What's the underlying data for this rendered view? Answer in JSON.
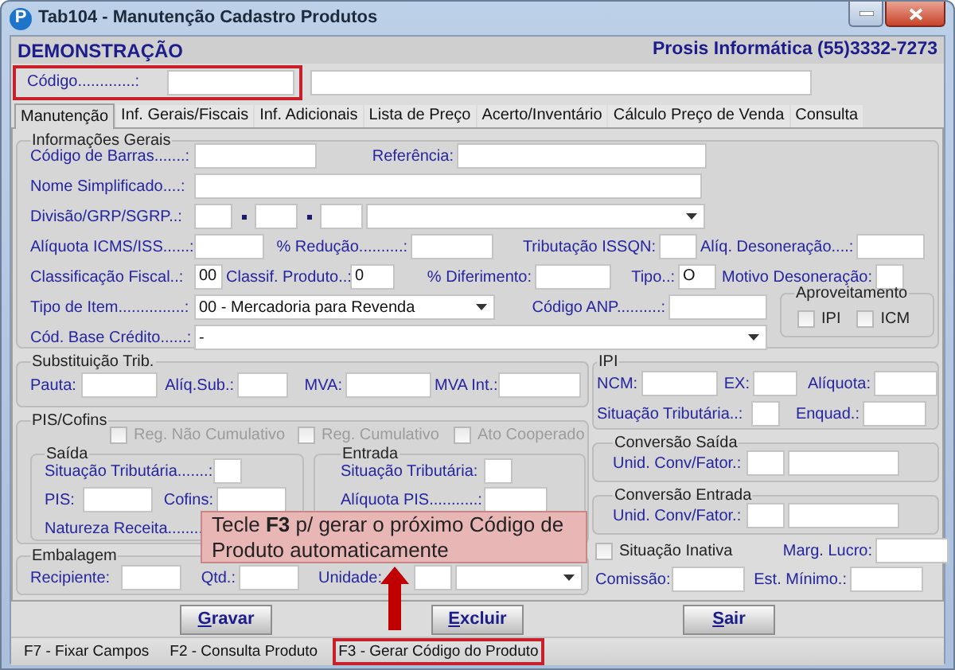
{
  "window": {
    "icon_letter": "P",
    "title": "Tab104 - Manutenção Cadastro Produtos"
  },
  "header": {
    "company": "DEMONSTRAÇÃO",
    "vendor": "Prosis Informática (55)3332-7273"
  },
  "code_row": {
    "highlighted": true,
    "items": [
      {
        "kind": "label",
        "text": "Código.............:"
      },
      {
        "kind": "input"
      },
      {
        "kind": "input"
      }
    ]
  },
  "tabs": [
    {
      "label": "Manutenção",
      "selected": true
    },
    {
      "label": "Inf. Gerais/Fiscais",
      "selected": false
    },
    {
      "label": "Inf. Adicionais",
      "selected": false
    },
    {
      "label": "Lista de Preço",
      "selected": false
    },
    {
      "label": "Acerto/Inventário",
      "selected": false
    },
    {
      "label": "Cálculo Preço de Venda",
      "selected": false
    },
    {
      "label": "Consulta",
      "selected": false
    }
  ],
  "general": {
    "title": "Informações Gerais",
    "rows": [
      {
        "fields": [
          {
            "kind": "label",
            "text": "Código de Barras.......:"
          },
          {
            "kind": "input"
          },
          {
            "kind": "label",
            "text": "Referência:"
          },
          {
            "kind": "input"
          }
        ]
      },
      {
        "fields": [
          {
            "kind": "label",
            "text": "Nome Simplificado....:"
          },
          {
            "kind": "input"
          }
        ]
      },
      {
        "fields": [
          {
            "kind": "label",
            "text": "Divisão/GRP/SGRP..:"
          },
          {
            "kind": "input"
          },
          {
            "kind": "dot"
          },
          {
            "kind": "input"
          },
          {
            "kind": "dot"
          },
          {
            "kind": "input"
          },
          {
            "kind": "select"
          }
        ]
      },
      {
        "fields": [
          {
            "kind": "label",
            "text": "Alíquota ICMS/ISS......:"
          },
          {
            "kind": "input"
          },
          {
            "kind": "label",
            "text": "% Redução..........:"
          },
          {
            "kind": "input"
          },
          {
            "kind": "label",
            "text": "Tributação ISSQN:"
          },
          {
            "kind": "input"
          },
          {
            "kind": "label",
            "text": "Alíq. Desoneração....:"
          },
          {
            "kind": "input"
          }
        ]
      },
      {
        "fields": [
          {
            "kind": "label",
            "text": "Classificação Fiscal..:"
          },
          {
            "kind": "input",
            "value": "00"
          },
          {
            "kind": "label",
            "text": "Classif. Produto..:"
          },
          {
            "kind": "input",
            "value": "0"
          },
          {
            "kind": "label",
            "text": "% Diferimento:"
          },
          {
            "kind": "input"
          },
          {
            "kind": "label",
            "text": "Tipo..:"
          },
          {
            "kind": "input",
            "value": "O"
          },
          {
            "kind": "label",
            "text": "Motivo Desoneração:"
          },
          {
            "kind": "input"
          }
        ]
      }
    ],
    "side_rows": [
      {
        "fields": [
          {
            "kind": "label",
            "text": "Tipo de Item...............:"
          },
          {
            "kind": "select",
            "value": "00 - Mercadoria para Revenda"
          },
          {
            "kind": "label",
            "text": "Código ANP..........:"
          },
          {
            "kind": "input"
          }
        ]
      },
      {
        "fields": [
          {
            "kind": "label",
            "text": "Cód. Base Crédito......:"
          },
          {
            "kind": "select",
            "value": "-"
          }
        ]
      }
    ],
    "aproveitamento": {
      "title": "Aproveitamento",
      "options": [
        {
          "kind": "check",
          "label": "IPI",
          "checked": false,
          "disabled": false
        },
        {
          "kind": "check",
          "label": "ICM",
          "checked": false,
          "disabled": false
        }
      ]
    }
  },
  "substituicao": {
    "title": "Substituição Trib.",
    "rows": [
      {
        "fields": [
          {
            "kind": "label",
            "text": "Pauta:"
          },
          {
            "kind": "input"
          },
          {
            "kind": "label",
            "text": "Alíq.Sub.:"
          },
          {
            "kind": "input"
          },
          {
            "kind": "label",
            "text": "MVA:"
          },
          {
            "kind": "input"
          },
          {
            "kind": "label",
            "text": "MVA Int.:"
          },
          {
            "kind": "input"
          }
        ]
      }
    ]
  },
  "pis_cofins": {
    "title": "PIS/Cofins",
    "options": [
      {
        "kind": "check",
        "label": "Reg. Não Cumulativo",
        "checked": false,
        "disabled": true
      },
      {
        "kind": "check",
        "label": "Reg. Cumulativo",
        "checked": false,
        "disabled": true
      },
      {
        "kind": "check",
        "label": "Ato Cooperado",
        "checked": false,
        "disabled": true
      }
    ],
    "saida": {
      "title": "Saída",
      "rows": [
        {
          "fields": [
            {
              "kind": "label",
              "text": "Situação Tributária.......:"
            },
            {
              "kind": "input"
            }
          ]
        },
        {
          "fields": [
            {
              "kind": "label",
              "text": "PIS:"
            },
            {
              "kind": "input"
            },
            {
              "kind": "label",
              "text": "Cofins:"
            },
            {
              "kind": "input"
            }
          ]
        },
        {
          "fields": [
            {
              "kind": "label",
              "text": "Natureza Receita........"
            }
          ]
        }
      ]
    },
    "entrada": {
      "title": "Entrada",
      "rows": [
        {
          "fields": [
            {
              "kind": "label",
              "text": "Situação Tributária:"
            },
            {
              "kind": "input"
            }
          ]
        },
        {
          "fields": [
            {
              "kind": "label",
              "text": "Alíquota PIS...........:"
            },
            {
              "kind": "input"
            }
          ]
        }
      ]
    }
  },
  "embalagem": {
    "title": "Embalagem",
    "rows": [
      {
        "fields": [
          {
            "kind": "label",
            "text": "Recipiente:"
          },
          {
            "kind": "input"
          },
          {
            "kind": "label",
            "text": "Qtd.:"
          },
          {
            "kind": "input"
          },
          {
            "kind": "label",
            "text": "Unidade:"
          },
          {
            "kind": "input"
          },
          {
            "kind": "select"
          }
        ]
      }
    ]
  },
  "ipi": {
    "title": "IPI",
    "rows": [
      {
        "fields": [
          {
            "kind": "label",
            "text": "NCM:"
          },
          {
            "kind": "input"
          },
          {
            "kind": "label",
            "text": "EX:"
          },
          {
            "kind": "input"
          },
          {
            "kind": "label",
            "text": "Alíquota:"
          },
          {
            "kind": "input"
          }
        ]
      },
      {
        "fields": [
          {
            "kind": "label",
            "text": "Situação Tributária..:"
          },
          {
            "kind": "input"
          },
          {
            "kind": "label",
            "text": "Enquad.:"
          },
          {
            "kind": "input"
          }
        ]
      }
    ]
  },
  "conversao_saida": {
    "title": "Conversão Saída",
    "rows": [
      {
        "fields": [
          {
            "kind": "label",
            "text": "Unid. Conv/Fator.:"
          },
          {
            "kind": "input"
          },
          {
            "kind": "input"
          }
        ]
      }
    ]
  },
  "conversao_entrada": {
    "title": "Conversão Entrada",
    "rows": [
      {
        "fields": [
          {
            "kind": "label",
            "text": "Unid. Conv/Fator.:"
          },
          {
            "kind": "input"
          },
          {
            "kind": "input"
          }
        ]
      }
    ]
  },
  "extra": {
    "rows": [
      {
        "fields": [
          {
            "kind": "check",
            "label": "Situação Inativa",
            "checked": false,
            "disabled": false
          },
          {
            "kind": "label",
            "text": "Marg. Lucro:"
          },
          {
            "kind": "input"
          }
        ]
      },
      {
        "fields": [
          {
            "kind": "label",
            "text": "Comissão:"
          },
          {
            "kind": "input"
          },
          {
            "kind": "label",
            "text": "Est. Mínimo.:"
          },
          {
            "kind": "input"
          }
        ]
      }
    ]
  },
  "callout": {
    "text": "Tecle **F3** p/ gerar o próximo Código de Produto automaticamente"
  },
  "buttons": [
    {
      "key": "G",
      "rest": "ravar"
    },
    {
      "key": "E",
      "rest": "xcluir"
    },
    {
      "key": "S",
      "rest": "air"
    }
  ],
  "status_bar": [
    {
      "text": "F7 - Fixar Campos",
      "highlighted": false
    },
    {
      "text": "F2 - Consulta Produto",
      "highlighted": false
    },
    {
      "text": "F3 - Gerar Código do Produto",
      "highlighted": true
    }
  ]
}
